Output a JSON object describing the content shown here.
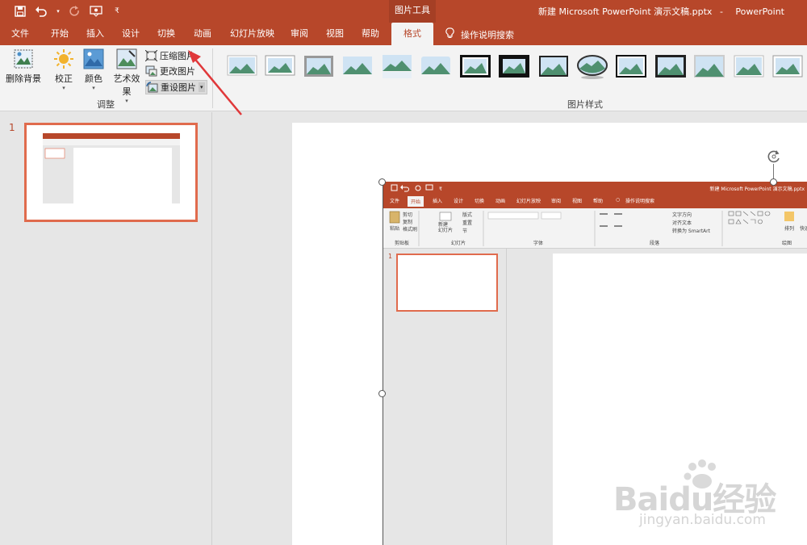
{
  "titlebar": {
    "context_tool": "图片工具",
    "document": "新建 Microsoft PowerPoint 演示文稿.pptx",
    "separator": "-",
    "app": "PowerPoint"
  },
  "tabs": [
    {
      "label": "文件"
    },
    {
      "label": "开始"
    },
    {
      "label": "插入"
    },
    {
      "label": "设计"
    },
    {
      "label": "切换"
    },
    {
      "label": "动画"
    },
    {
      "label": "幻灯片放映"
    },
    {
      "label": "审阅"
    },
    {
      "label": "视图"
    },
    {
      "label": "帮助"
    },
    {
      "label": "格式"
    }
  ],
  "tell_me": "操作说明搜索",
  "ribbon": {
    "remove_bg": "删除背景",
    "corrections": "校正",
    "color": "颜色",
    "artistic": "艺术效果",
    "compress": "压缩图片",
    "change": "更改图片",
    "reset": "重设图片",
    "group_adjust": "调整",
    "group_styles": "图片样式"
  },
  "slides": {
    "number": "1"
  },
  "embedded": {
    "document": "新建 Microsoft PowerPoint 演示文稿.pptx",
    "tabs": [
      "文件",
      "开始",
      "插入",
      "设计",
      "切换",
      "动画",
      "幻灯片放映",
      "审阅",
      "视图",
      "帮助"
    ],
    "tell_me": "操作说明搜索",
    "paste": "粘贴",
    "cut": "剪切",
    "copy": "复制",
    "format_painter": "格式刷",
    "new_slide": "新建\n幻灯片",
    "layout": "版式",
    "reset": "重置",
    "section": "节",
    "text_direction": "文字方向",
    "align_text": "对齐文本",
    "smartart": "转换为 SmartArt",
    "arrange": "排列",
    "quick_styles": "快速",
    "groups": [
      "剪贴板",
      "幻灯片",
      "字体",
      "段落",
      "绘图"
    ],
    "slide_number": "1"
  },
  "watermark": {
    "brand": "Baidu经验",
    "url": "jingyan.baidu.com"
  },
  "colors": {
    "accent": "#b7472a",
    "ribbon": "#f3f3f3",
    "thumb_border": "#e06b4d",
    "arrow": "#e0383a"
  }
}
